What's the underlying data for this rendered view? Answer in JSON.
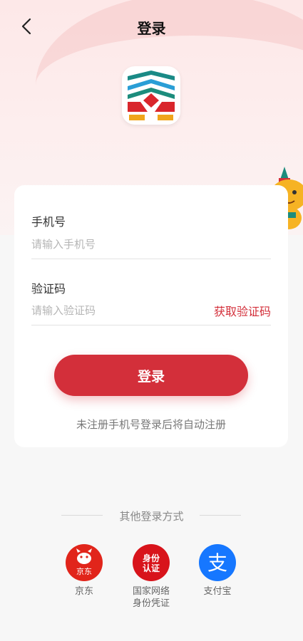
{
  "nav": {
    "title": "登录"
  },
  "form": {
    "phone_label": "手机号",
    "phone_placeholder": "请输入手机号",
    "code_label": "验证码",
    "code_placeholder": "请输入验证码",
    "get_code": "获取验证码",
    "login_button": "登录",
    "hint": "未注册手机号登录后将自动注册"
  },
  "other_login": {
    "title": "其他登录方式",
    "providers": [
      {
        "label": "京东",
        "icon": "jd-icon",
        "icon_text": "京东",
        "color": "#e1251b"
      },
      {
        "label_line1": "国家网络",
        "label_line2": "身份凭证",
        "icon": "id-auth-icon",
        "icon_text_line1": "身份",
        "icon_text_line2": "认证",
        "color": "#d8141b"
      },
      {
        "label": "支付宝",
        "icon": "alipay-icon",
        "icon_text": "支",
        "color": "#1677ff"
      }
    ]
  },
  "colors": {
    "accent": "#d32f3a",
    "background": "#f7f7f7"
  }
}
